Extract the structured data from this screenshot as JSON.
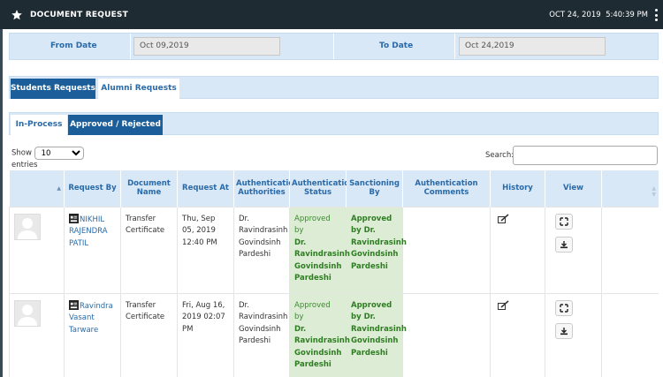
{
  "header": {
    "icon": "star-icon",
    "title": "DOCUMENT REQUEST",
    "date": "OCT 24, 2019",
    "time": "5:40:39 PM",
    "menu_icon": "kebab-menu-icon"
  },
  "filters": {
    "from_label": "From Date",
    "from_value": "Oct 09,2019",
    "to_label": "To Date",
    "to_value": "Oct 24,2019"
  },
  "tabs": {
    "primary": [
      {
        "label": "Students Requests",
        "active": true
      },
      {
        "label": "Alumni Requests",
        "active": false
      }
    ],
    "secondary": [
      {
        "label": "In-Process",
        "active": false
      },
      {
        "label": "Approved / Rejected",
        "active": true
      }
    ]
  },
  "table_controls": {
    "show_label": "Show",
    "page_size": "10",
    "entries_label": "entries",
    "search_label": "Search:"
  },
  "table": {
    "columns": [
      "",
      "Request By",
      "Document Name",
      "Request At",
      "Authentication Authorities",
      "Authentication Status",
      "Sanctioning By",
      "Authentication Comments",
      "History",
      "View",
      ""
    ],
    "rows": [
      {
        "request_by": "NIKHIL RAJENDRA PATIL",
        "document": "Transfer Certificate",
        "request_at": "Thu, Sep 05, 2019 12:40 PM",
        "authority": "Dr. Ravindrasinh Govindsinh Pardeshi",
        "status_prefix": "Approved by",
        "status_name": "Dr. Ravindrasinh Govindsinh Pardeshi",
        "sanction": "Approved by Dr. Ravindrasinh Govindsinh Pardeshi",
        "comments": ""
      },
      {
        "request_by": "Ravindra Vasant Tarware",
        "document": "Transfer Certificate",
        "request_at": "Fri, Aug 16, 2019 02:07 PM",
        "authority": "Dr. Ravindrasinh Govindsinh Pardeshi",
        "status_prefix": "Approved by",
        "status_name": "Dr. Ravindrasinh Govindsinh Pardeshi",
        "sanction": "Approved by Dr. Ravindrasinh Govindsinh Pardeshi",
        "comments": ""
      }
    ]
  },
  "colors": {
    "topbar": "#1f2b33",
    "header_bg": "#d8e8f7",
    "accent": "#1b5e99",
    "approved_bg": "#ddedd5",
    "approved_text": "#2f7d22"
  }
}
